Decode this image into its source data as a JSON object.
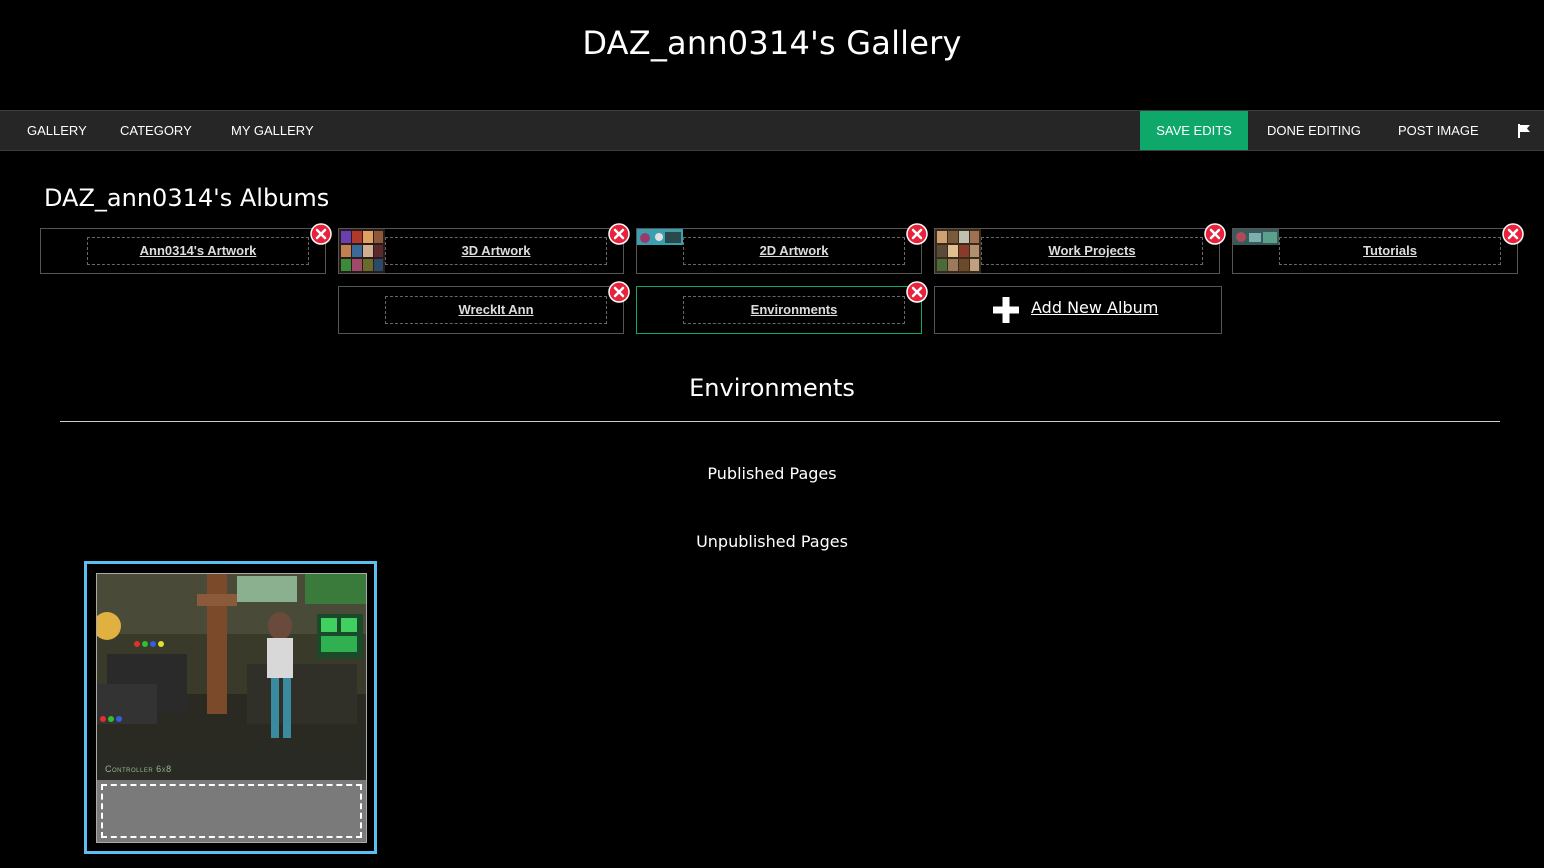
{
  "header": {
    "title": "DAZ_ann0314's Gallery"
  },
  "nav": {
    "gallery": "GALLERY",
    "category": "CATEGORY",
    "my_gallery": "MY GALLERY",
    "save_edits": "SAVE EDITS",
    "done_editing": "DONE EDITING",
    "post_image": "POST IMAGE",
    "flag_icon": "flag-icon"
  },
  "albums": {
    "title": "DAZ_ann0314's Albums",
    "items": [
      {
        "label": "Ann0314's Artwork"
      },
      {
        "label": "3D Artwork"
      },
      {
        "label": "2D Artwork"
      },
      {
        "label": "Work Projects"
      },
      {
        "label": "Tutorials"
      },
      {
        "label": "WreckIt Ann"
      },
      {
        "label": "Environments"
      }
    ],
    "add_new": "Add New Album"
  },
  "current_album": {
    "title": "Environments",
    "published_heading": "Published Pages",
    "unpublished_heading": "Unpublished Pages",
    "image_watermark": "Controller 6x8"
  },
  "colors": {
    "save_button": "#0fa86b",
    "selected_image_border": "#5bc0f0",
    "delete_icon": "#e8223a"
  }
}
